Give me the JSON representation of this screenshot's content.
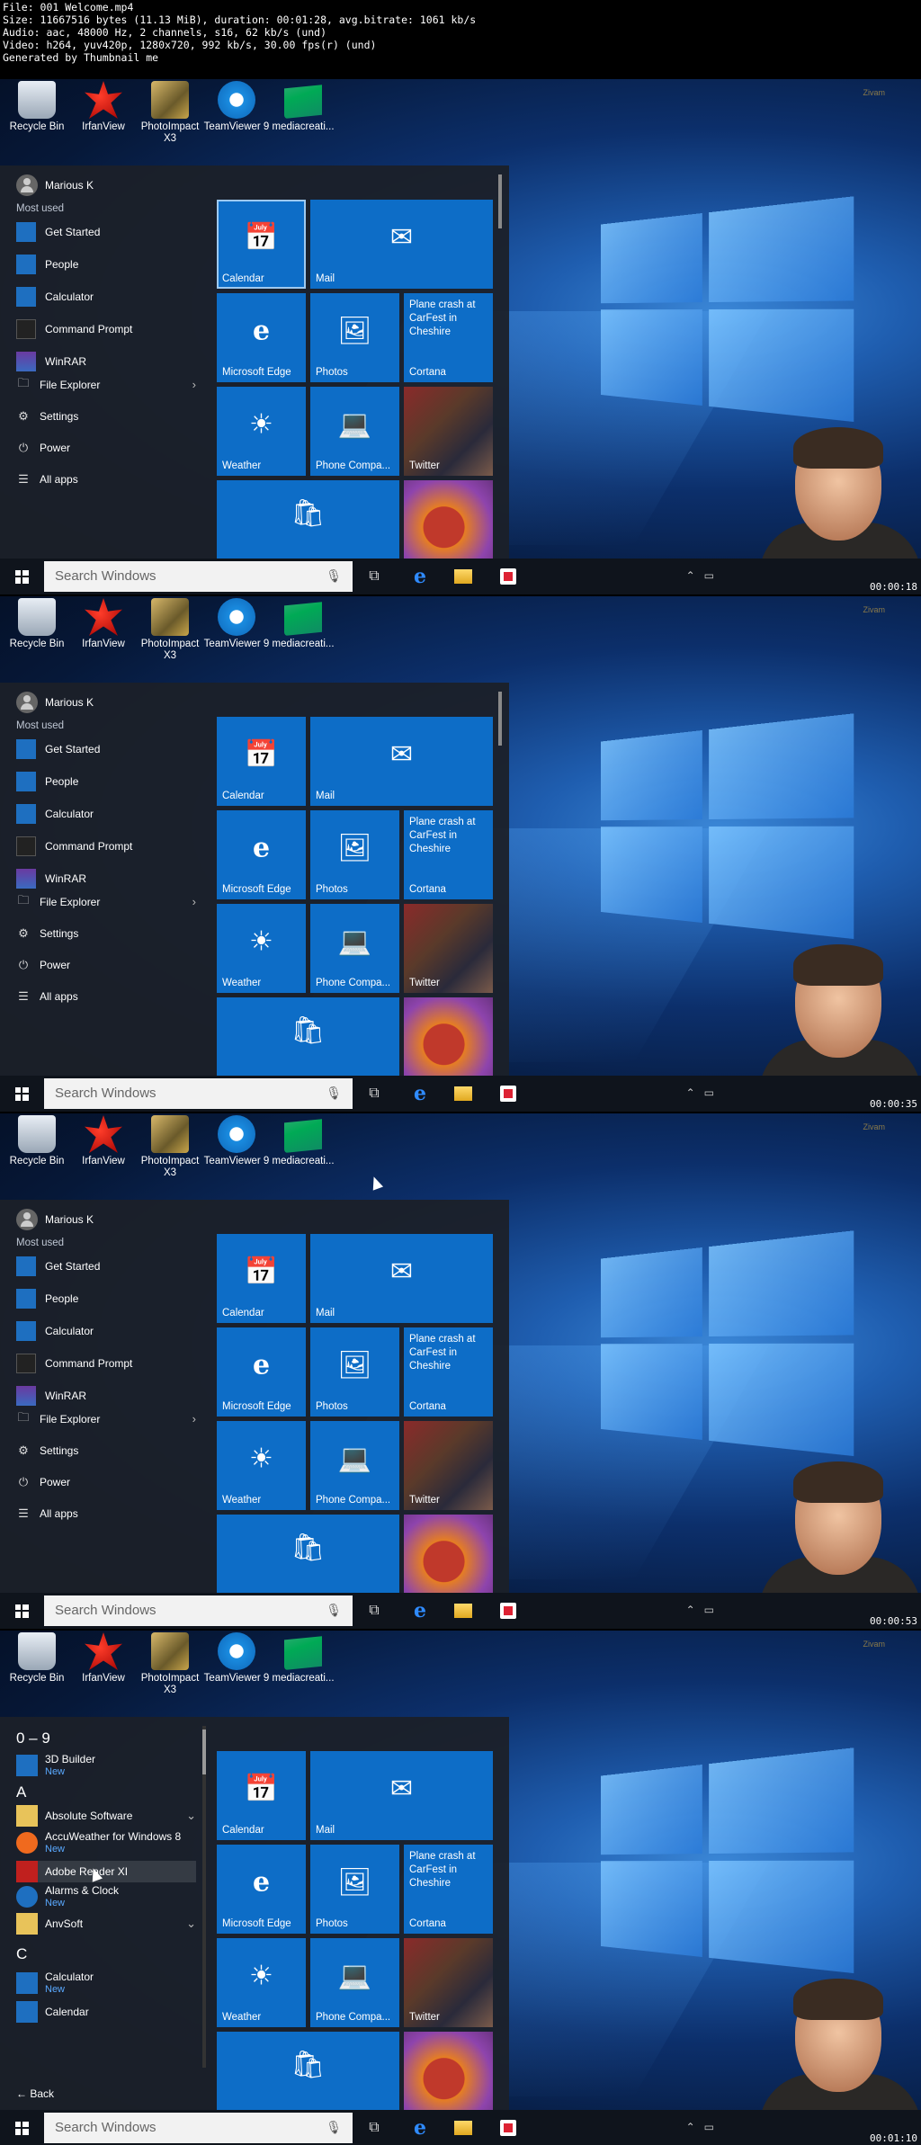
{
  "header": {
    "lines": [
      "File: 001 Welcome.mp4",
      "Size: 11667516 bytes (11.13 MiB), duration: 00:01:28, avg.bitrate: 1061 kb/s",
      "Audio: aac, 48000 Hz, 2 channels, s16, 62 kb/s (und)",
      "Video: h264, yuv420p, 1280x720, 992 kb/s, 30.00 fps(r) (und)",
      "Generated by Thumbnail me"
    ]
  },
  "desktop": {
    "icons": [
      {
        "label": "Recycle Bin",
        "icon": "recycle-bin-icon"
      },
      {
        "label": "IrfanView",
        "icon": "irfanview-icon"
      },
      {
        "label": "PhotoImpact X3",
        "icon": "photoimpact-icon"
      },
      {
        "label": "TeamViewer 9",
        "icon": "teamviewer-icon"
      },
      {
        "label": "mediacreati...",
        "icon": "mediacreation-icon"
      }
    ]
  },
  "start_menu": {
    "user": "Marious K",
    "most_used_label": "Most used",
    "most_used": [
      {
        "label": "Get Started",
        "icon": "lightbulb-icon"
      },
      {
        "label": "People",
        "icon": "people-icon"
      },
      {
        "label": "Calculator",
        "icon": "calculator-icon"
      },
      {
        "label": "Command Prompt",
        "icon": "command-prompt-icon"
      },
      {
        "label": "WinRAR",
        "icon": "winrar-icon"
      }
    ],
    "system": [
      {
        "label": "File Explorer",
        "icon": "folder-icon",
        "glyph": "🗀"
      },
      {
        "label": "Settings",
        "icon": "gear-icon",
        "glyph": "⚙"
      },
      {
        "label": "Power",
        "icon": "power-icon",
        "glyph": "⏻"
      },
      {
        "label": "All apps",
        "icon": "list-icon",
        "glyph": "☰"
      }
    ],
    "tiles": {
      "calendar": "Calendar",
      "mail": "Mail",
      "edge": "Microsoft Edge",
      "photos": "Photos",
      "cortana_news": "Plane crash at CarFest in Cheshire",
      "cortana": "Cortana",
      "weather": "Weather",
      "phone": "Phone Compa...",
      "twitter": "Twitter"
    }
  },
  "all_apps": {
    "groups": [
      "0 – 9",
      "A",
      "C"
    ],
    "items": [
      {
        "name": "3D Builder",
        "badge": "New"
      },
      {
        "name": "Absolute Software",
        "badge": ""
      },
      {
        "name": "AccuWeather for Windows 8",
        "badge": "New"
      },
      {
        "name": "Adobe Reader XI",
        "badge": ""
      },
      {
        "name": "Alarms & Clock",
        "badge": "New"
      },
      {
        "name": "AnvSoft",
        "badge": ""
      },
      {
        "name": "Calculator",
        "badge": "New"
      },
      {
        "name": "Calendar",
        "badge": ""
      }
    ],
    "back": "Back"
  },
  "taskbar": {
    "search_placeholder": "Search Windows"
  },
  "frames": [
    {
      "timestamp": "00:00:18"
    },
    {
      "timestamp": "00:00:35"
    },
    {
      "timestamp": "00:00:53"
    },
    {
      "timestamp": "00:01:10"
    }
  ]
}
